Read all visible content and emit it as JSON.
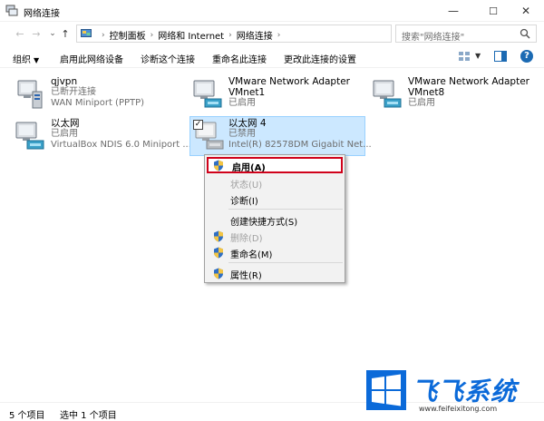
{
  "window": {
    "title": "网络连接",
    "minimize": "—",
    "maximize": "☐",
    "close": "✕"
  },
  "nav": {
    "back": "←",
    "forward": "→",
    "recent": "⌄",
    "up": "↑"
  },
  "address": {
    "crumbs": [
      "控制面板",
      "网络和 Internet",
      "网络连接"
    ],
    "refresh": "⟳",
    "search_placeholder": "搜索\"网络连接\""
  },
  "toolbar": {
    "organize": "组织",
    "enable_device": "启用此网络设备",
    "diagnose": "诊断这个连接",
    "rename": "重命名此连接",
    "change_settings": "更改此连接的设置",
    "help": "?"
  },
  "connections": [
    {
      "name": "qjvpn",
      "status": "已断开连接",
      "device": "WAN Miniport (PPTP)",
      "icon": "vpn-connection-icon"
    },
    {
      "name": "VMware Network Adapter",
      "name2": "VMnet1",
      "status": "已启用",
      "icon": "network-adapter-icon"
    },
    {
      "name": "VMware Network Adapter",
      "name2": "VMnet8",
      "status": "已启用",
      "icon": "network-adapter-icon"
    },
    {
      "name": "以太网",
      "status": "已启用",
      "device": "VirtualBox NDIS 6.0 Miniport ...",
      "icon": "network-adapter-icon"
    },
    {
      "name": "以太网 4",
      "status": "已禁用",
      "device": "Intel(R) 82578DM Gigabit Net...",
      "icon": "disabled-network-adapter-icon",
      "selected": true,
      "checked": "✓"
    }
  ],
  "context_menu": {
    "enable": "启用(A)",
    "status": "状态(U)",
    "diagnose": "诊断(I)",
    "create_shortcut": "创建快捷方式(S)",
    "delete": "删除(D)",
    "rename": "重命名(M)",
    "properties": "属性(R)"
  },
  "statusbar": {
    "count": "5 个项目",
    "selected": "选中 1 个项目"
  },
  "watermark": {
    "brand": "飞飞系统",
    "url": "www.feifeixitong.com"
  },
  "colors": {
    "accent": "#1b6ab3",
    "selection_bg": "#cce8ff",
    "highlight_border": "#d0021b",
    "brand": "#0b6ad9"
  }
}
